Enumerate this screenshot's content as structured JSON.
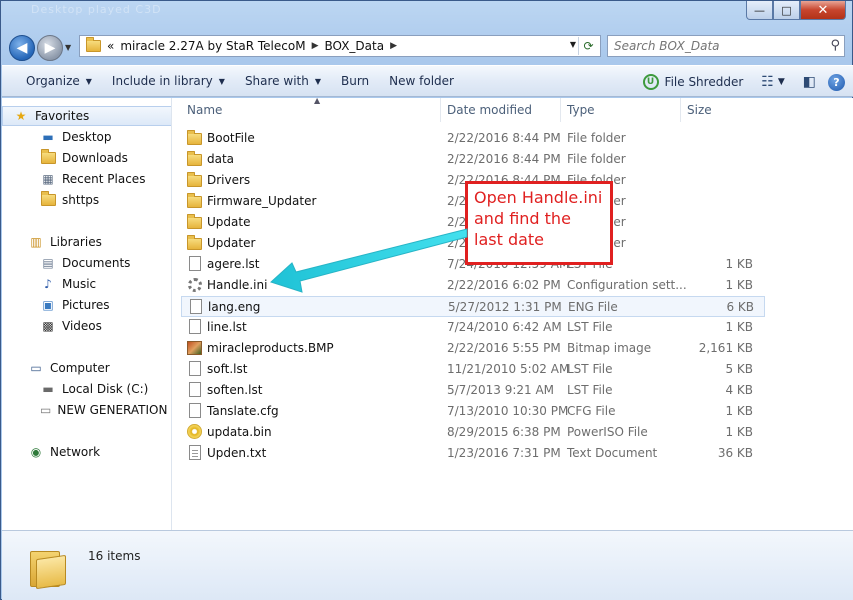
{
  "window": {
    "ghost_title": "Desktop          played          C3D",
    "minimize": "—",
    "maximize": "□",
    "close": "✕"
  },
  "address": {
    "overflow": "«",
    "crumbs": [
      "miracle 2.27A by StaR TelecoM",
      "BOX_Data"
    ],
    "search_placeholder": "Search BOX_Data"
  },
  "commands": {
    "organize": "Organize",
    "include": "Include in library",
    "share": "Share with",
    "burn": "Burn",
    "new_folder": "New folder",
    "file_shredder": "File Shredder"
  },
  "sidebar": {
    "favorites": "Favorites",
    "desktop": "Desktop",
    "downloads": "Downloads",
    "recent": "Recent Places",
    "shttps": "shttps",
    "libraries": "Libraries",
    "documents": "Documents",
    "music": "Music",
    "pictures": "Pictures",
    "videos": "Videos",
    "computer": "Computer",
    "local_disk": "Local Disk (C:)",
    "new_generation": "NEW GENERATION (",
    "network": "Network"
  },
  "columns": {
    "name": "Name",
    "date": "Date modified",
    "type": "Type",
    "size": "Size"
  },
  "files": [
    {
      "name": "BootFile",
      "date": "2/22/2016 8:44 PM",
      "type": "File folder",
      "size": "",
      "icon": "folder"
    },
    {
      "name": "data",
      "date": "2/22/2016 8:44 PM",
      "type": "File folder",
      "size": "",
      "icon": "folder"
    },
    {
      "name": "Drivers",
      "date": "2/22/2016 8:44 PM",
      "type": "File folder",
      "size": "",
      "icon": "folder"
    },
    {
      "name": "Firmware_Updater",
      "date": "2/22/2016 8:44 PM",
      "type": "File folder",
      "size": "",
      "icon": "folder"
    },
    {
      "name": "Update",
      "date": "2/22/2016 8:44 PM",
      "type": "File folder",
      "size": "",
      "icon": "folder"
    },
    {
      "name": "Updater",
      "date": "2/22/2016 8:44 PM",
      "type": "File folder",
      "size": "",
      "icon": "folder"
    },
    {
      "name": "agere.lst",
      "date": "7/24/2010 12:59 AM",
      "type": "LST File",
      "size": "1 KB",
      "icon": "doc"
    },
    {
      "name": "Handle.ini",
      "date": "2/22/2016 6:02 PM",
      "type": "Configuration sett...",
      "size": "1 KB",
      "icon": "gear"
    },
    {
      "name": "lang.eng",
      "date": "5/27/2012 1:31 PM",
      "type": "ENG File",
      "size": "6 KB",
      "icon": "doc"
    },
    {
      "name": "line.lst",
      "date": "7/24/2010 6:42 AM",
      "type": "LST File",
      "size": "1 KB",
      "icon": "doc"
    },
    {
      "name": "miracleproducts.BMP",
      "date": "2/22/2016 5:55 PM",
      "type": "Bitmap image",
      "size": "2,161 KB",
      "icon": "bmp"
    },
    {
      "name": "soft.lst",
      "date": "11/21/2010 5:02 AM",
      "type": "LST File",
      "size": "5 KB",
      "icon": "doc"
    },
    {
      "name": "soften.lst",
      "date": "5/7/2013 9:21 AM",
      "type": "LST File",
      "size": "4 KB",
      "icon": "doc"
    },
    {
      "name": "Tanslate.cfg",
      "date": "7/13/2010 10:30 PM",
      "type": "CFG File",
      "size": "1 KB",
      "icon": "doc"
    },
    {
      "name": "updata.bin",
      "date": "8/29/2015 6:38 PM",
      "type": "PowerISO File",
      "size": "1 KB",
      "icon": "disc"
    },
    {
      "name": "Upden.txt",
      "date": "1/23/2016 7:31 PM",
      "type": "Text Document",
      "size": "36 KB",
      "icon": "doc-lines"
    }
  ],
  "annotation": {
    "text": "Open Handle.ini and find the last date",
    "color": "#e02020",
    "arrow_color": "#33d6e6"
  },
  "details": {
    "count": "16 items"
  }
}
